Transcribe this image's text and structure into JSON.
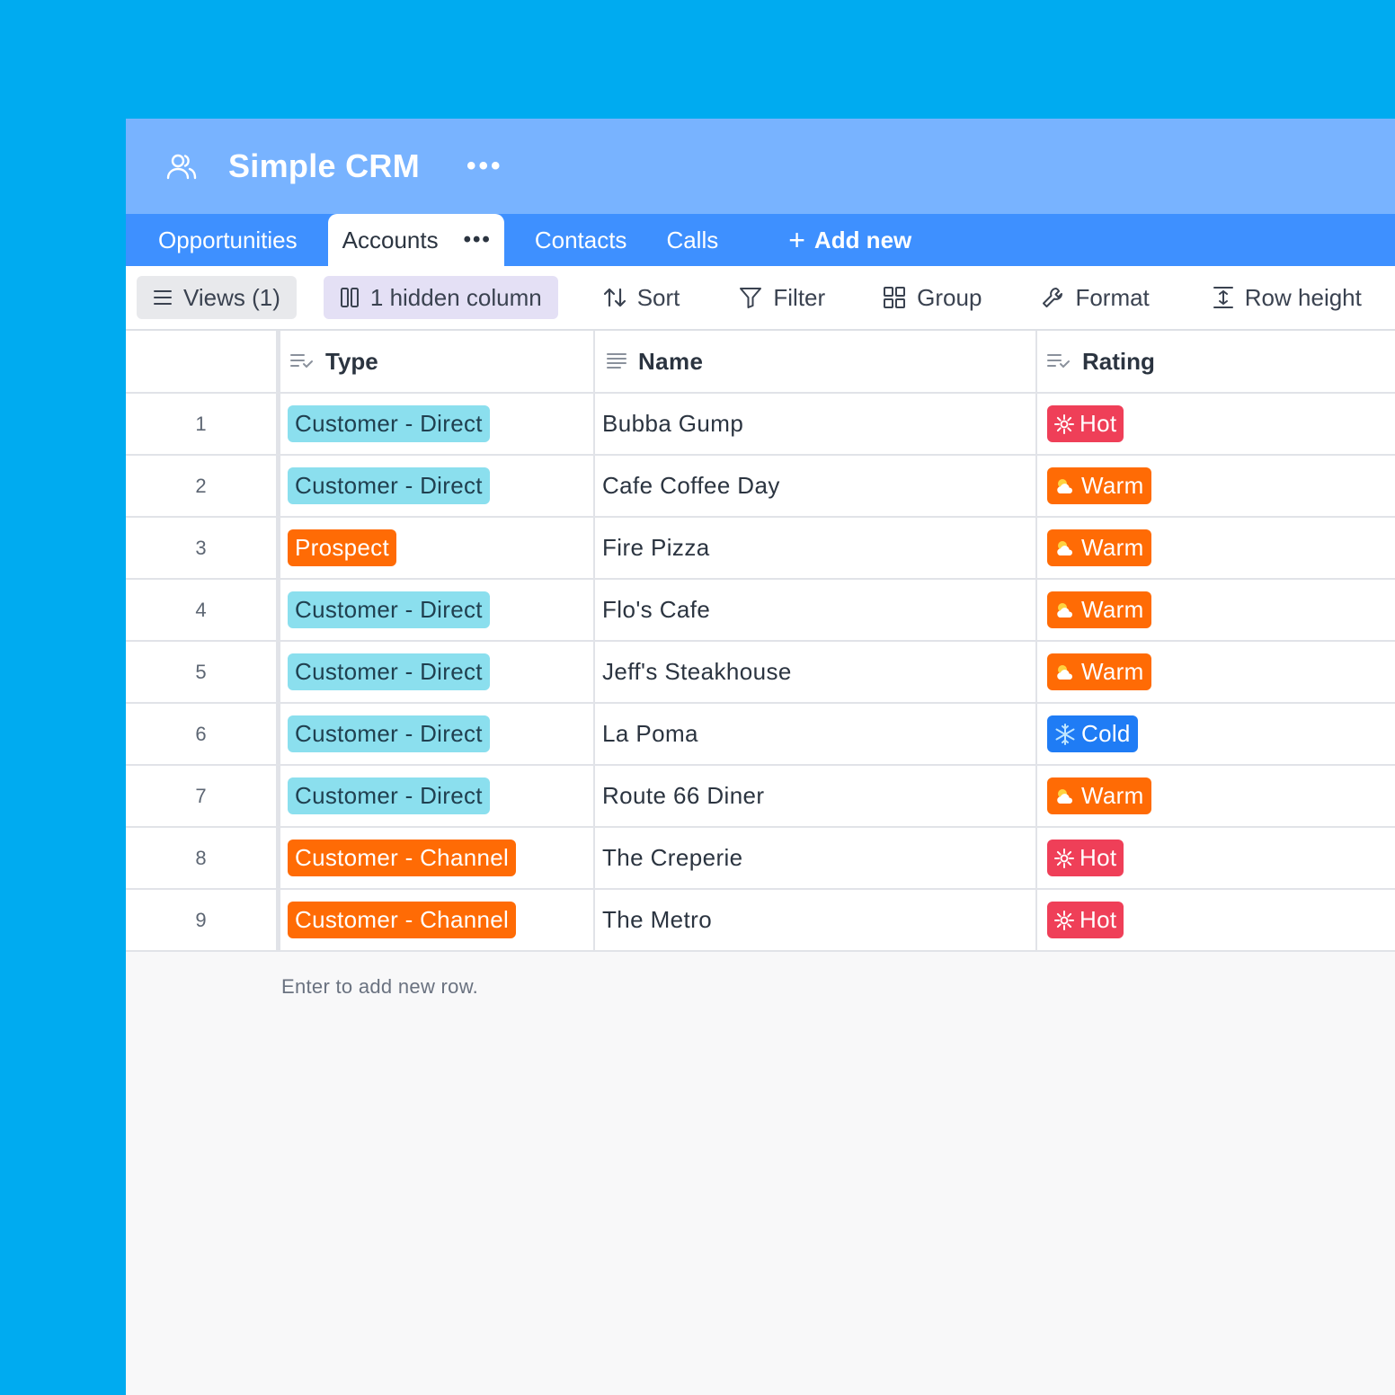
{
  "app": {
    "title": "Simple CRM",
    "more": "•••"
  },
  "tabs": {
    "items": [
      {
        "label": "Opportunities"
      },
      {
        "label": "Accounts",
        "more": "•••"
      },
      {
        "label": "Contacts"
      },
      {
        "label": "Calls"
      }
    ],
    "add_label": "Add new",
    "add_plus": "+"
  },
  "toolbar": {
    "views": "Views (1)",
    "hidden": "1 hidden column",
    "sort": "Sort",
    "filter": "Filter",
    "group": "Group",
    "format": "Format",
    "row_height": "Row height"
  },
  "table": {
    "columns": {
      "type": "Type",
      "name": "Name",
      "rating": "Rating"
    },
    "rows": [
      {
        "num": "1",
        "type": "Customer - Direct",
        "name": "Bubba Gump",
        "rating": "Hot"
      },
      {
        "num": "2",
        "type": "Customer - Direct",
        "name": "Cafe Coffee Day",
        "rating": "Warm"
      },
      {
        "num": "3",
        "type": "Prospect",
        "name": "Fire Pizza",
        "rating": "Warm"
      },
      {
        "num": "4",
        "type": "Customer - Direct",
        "name": "Flo's Cafe",
        "rating": "Warm"
      },
      {
        "num": "5",
        "type": "Customer - Direct",
        "name": "Jeff's Steakhouse",
        "rating": "Warm"
      },
      {
        "num": "6",
        "type": "Customer - Direct",
        "name": "La Poma",
        "rating": "Cold"
      },
      {
        "num": "7",
        "type": "Customer - Direct",
        "name": "Route 66 Diner",
        "rating": "Warm"
      },
      {
        "num": "8",
        "type": "Customer - Channel",
        "name": "The Creperie",
        "rating": "Hot"
      },
      {
        "num": "9",
        "type": "Customer - Channel",
        "name": "The Metro",
        "rating": "Hot"
      }
    ],
    "add_hint": "Enter to add new row."
  },
  "colors": {
    "background": "#00abf0",
    "header": "#78b3ff",
    "tabs": "#3e90ff",
    "direct": "#8bdfee",
    "orange": "#ff6b05",
    "hot": "#ef3f58",
    "cold": "#1f7cf5"
  }
}
